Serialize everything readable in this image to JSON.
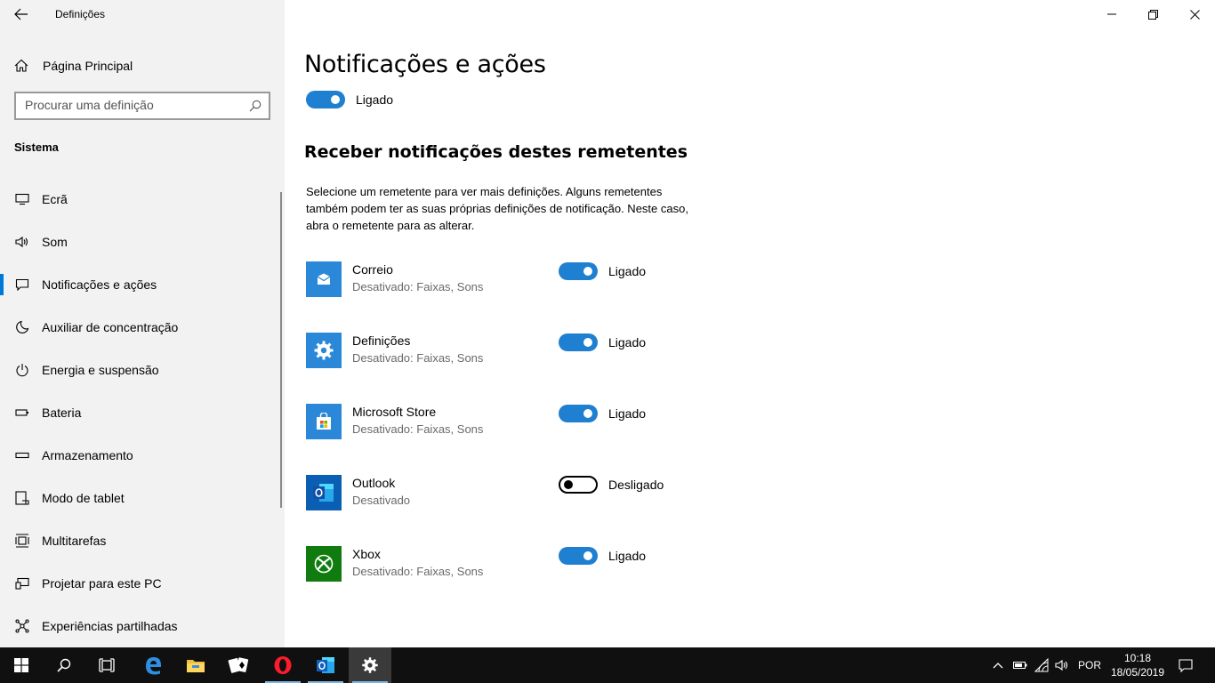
{
  "window": {
    "title": "Definições"
  },
  "sidebar": {
    "home_label": "Página Principal",
    "search_placeholder": "Procurar uma definição",
    "section_title": "Sistema",
    "items": [
      {
        "label": "Ecrã",
        "icon": "monitor-icon"
      },
      {
        "label": "Som",
        "icon": "speaker-icon"
      },
      {
        "label": "Notificações e ações",
        "icon": "notification-icon",
        "active": true
      },
      {
        "label": "Auxiliar de concentração",
        "icon": "moon-icon"
      },
      {
        "label": "Energia e suspensão",
        "icon": "power-icon"
      },
      {
        "label": "Bateria",
        "icon": "battery-icon"
      },
      {
        "label": "Armazenamento",
        "icon": "storage-icon"
      },
      {
        "label": "Modo de tablet",
        "icon": "tablet-icon"
      },
      {
        "label": "Multitarefas",
        "icon": "multitask-icon"
      },
      {
        "label": "Projetar para este PC",
        "icon": "project-icon"
      },
      {
        "label": "Experiências partilhadas",
        "icon": "share-icon"
      }
    ]
  },
  "main": {
    "title": "Notificações e ações",
    "master_toggle": {
      "state": "on",
      "label": "Ligado"
    },
    "senders_heading": "Receber notificações destes remetentes",
    "senders_description": "Selecione um remetente para ver mais definições. Alguns remetentes também podem ter as suas próprias definições de notificação. Neste caso, abra o remetente para as alterar.",
    "senders": [
      {
        "name": "Correio",
        "sub": "Desativado: Faixas, Sons",
        "state": "on",
        "label": "Ligado",
        "icon": "mail-app-icon",
        "color": "#2b88d8"
      },
      {
        "name": "Definições",
        "sub": "Desativado: Faixas, Sons",
        "state": "on",
        "label": "Ligado",
        "icon": "settings-app-icon",
        "color": "#2b88d8"
      },
      {
        "name": "Microsoft Store",
        "sub": "Desativado: Faixas, Sons",
        "state": "on",
        "label": "Ligado",
        "icon": "store-app-icon",
        "color": "#2b88d8"
      },
      {
        "name": "Outlook",
        "sub": "Desativado",
        "state": "off",
        "label": "Desligado",
        "icon": "outlook-app-icon",
        "color": "#0a5fb4"
      },
      {
        "name": "Xbox",
        "sub": "Desativado: Faixas, Sons",
        "state": "on",
        "label": "Ligado",
        "icon": "xbox-app-icon",
        "color": "#107c10"
      }
    ]
  },
  "taskbar": {
    "language": "POR",
    "time": "10:18",
    "date": "18/05/2019"
  },
  "colors": {
    "accent": "#1f7fd0",
    "sidebar_bg": "#f2f2f2",
    "taskbar_bg": "#101010"
  }
}
